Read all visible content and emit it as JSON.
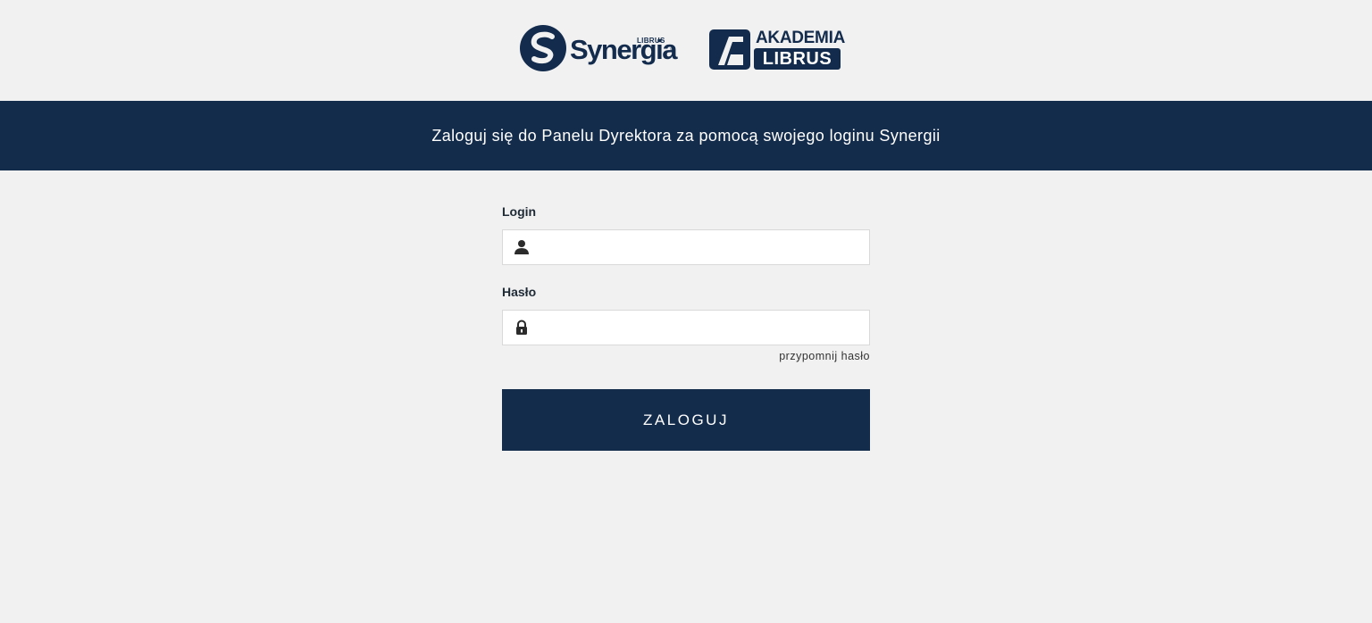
{
  "brand": {
    "synergia_word": "Synergia",
    "synergia_small": "LIBRUS",
    "synergia_reg": "®",
    "akademia_top": "AKADEMIA",
    "akademia_bottom": "LIBRUS"
  },
  "banner": {
    "text": "Zaloguj się do Panelu Dyrektora za pomocą swojego loginu Synergii"
  },
  "form": {
    "login_label": "Login",
    "login_value": "",
    "password_label": "Hasło",
    "password_value": "",
    "forgot_link": "przypomnij hasło",
    "submit_label": "ZALOGUJ"
  },
  "icons": {
    "login": "user-icon",
    "password": "lock-icon"
  },
  "colors": {
    "brand_navy": "#142c4c",
    "background": "#f1f1f1",
    "input_bg": "#ffffff"
  }
}
